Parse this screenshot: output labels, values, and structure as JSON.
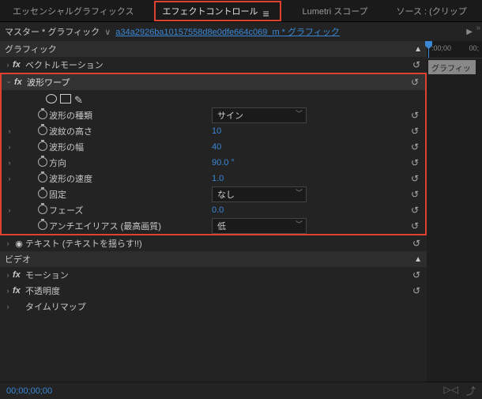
{
  "tabs": {
    "essential": "エッセンシャルグラフィックス",
    "effect": "エフェクトコントロール",
    "lumetri": "Lumetri スコープ",
    "source": "ソース : (クリップ"
  },
  "master": {
    "prefix": "マスター * グラフィック",
    "sep": "∨",
    "link": "a34a2926ba10157558d8e0dfe664c069_m * グラフィック"
  },
  "sections": {
    "graphic": "グラフィック",
    "video": "ビデオ"
  },
  "fx": {
    "vector_motion": "ベクトルモーション",
    "wave_warp": "波形ワープ",
    "text": "テキスト (テキストを揺らす!!)",
    "motion": "モーション",
    "opacity": "不透明度",
    "time_remap": "タイムリマップ"
  },
  "wave": {
    "type_label": "波形の種類",
    "type_value": "サイン",
    "height_label": "波紋の高さ",
    "height_value": "10",
    "width_label": "波形の幅",
    "width_value": "40",
    "direction_label": "方向",
    "direction_value": "90.0 °",
    "speed_label": "波形の速度",
    "speed_value": "1.0",
    "pinning_label": "固定",
    "pinning_value": "なし",
    "phase_label": "フェーズ",
    "phase_value": "0.0",
    "aa_label": "アンチエイリアス (最高画質)",
    "aa_value": "低"
  },
  "timeline": {
    "t0": ":00;00",
    "t1": "00;",
    "clip": "グラフィック"
  },
  "footer": {
    "timecode": "00;00;00;00"
  },
  "reset_glyph": "↺",
  "collapse_glyph": "▲"
}
